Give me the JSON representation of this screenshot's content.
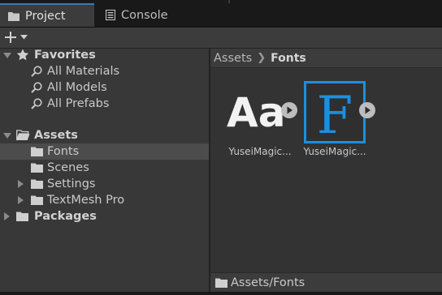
{
  "tabs": [
    {
      "label": "Project",
      "icon": "folder-icon",
      "active": true
    },
    {
      "label": "Console",
      "icon": "console-icon",
      "active": false
    }
  ],
  "toolbar": {
    "add_symbol": "+"
  },
  "tree": {
    "favorites": {
      "label": "Favorites",
      "items": [
        "All Materials",
        "All Models",
        "All Prefabs"
      ]
    },
    "assets": {
      "label": "Assets",
      "children": [
        "Fonts",
        "Scenes",
        "Settings",
        "TextMesh Pro"
      ],
      "selected": "Fonts"
    },
    "packages": {
      "label": "Packages"
    }
  },
  "breadcrumb": {
    "root": "Assets",
    "current": "Fonts"
  },
  "assets": [
    {
      "label": "YuseiMagic...",
      "preview_text": "Aa",
      "type": "font-asset"
    },
    {
      "label": "YuseiMagic...",
      "preview_text": "F",
      "type": "font-asset",
      "selected": true
    }
  ],
  "status": {
    "path": "Assets/Fonts"
  },
  "colors": {
    "accent_tab": "#3a79bb",
    "selected_asset_border": "#1a90e0",
    "font_glyph_blue": "#1a90e0",
    "panel_bg": "#383838",
    "content_bg": "#333333"
  }
}
